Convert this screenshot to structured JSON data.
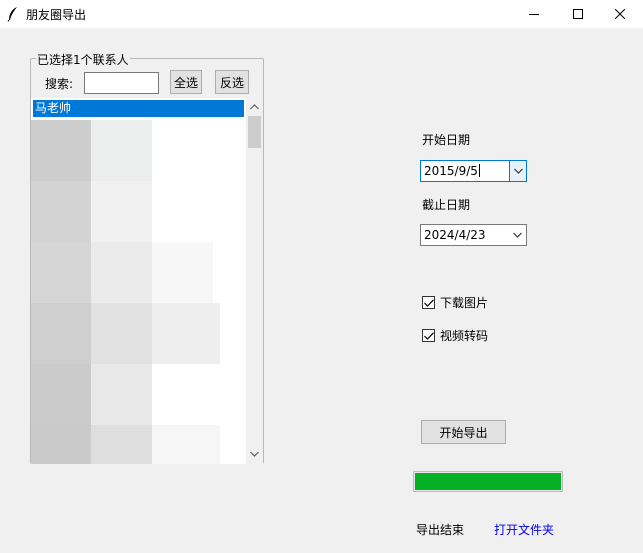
{
  "window": {
    "title": "朋友圈导出",
    "icon": "feather-icon"
  },
  "contacts": {
    "group_title": "已选择1个联系人",
    "search_label": "搜索:",
    "search_value": "",
    "select_all_label": "全选",
    "invert_label": "反选",
    "items": [
      "马老帅"
    ]
  },
  "dates": {
    "start_label": "开始日期",
    "start_value": "2015/9/5",
    "end_label": "截止日期",
    "end_value": "2024/4/23"
  },
  "options": {
    "download_images_label": "下载图片",
    "download_images_checked": true,
    "video_transcode_label": "视频转码",
    "video_transcode_checked": true
  },
  "export": {
    "button_label": "开始导出",
    "progress_percent": 100,
    "status_text": "导出结束",
    "open_folder_label": "打开文件夹"
  },
  "colors": {
    "selection": "#0078d7",
    "progress": "#06b025",
    "link": "#0000ee"
  }
}
